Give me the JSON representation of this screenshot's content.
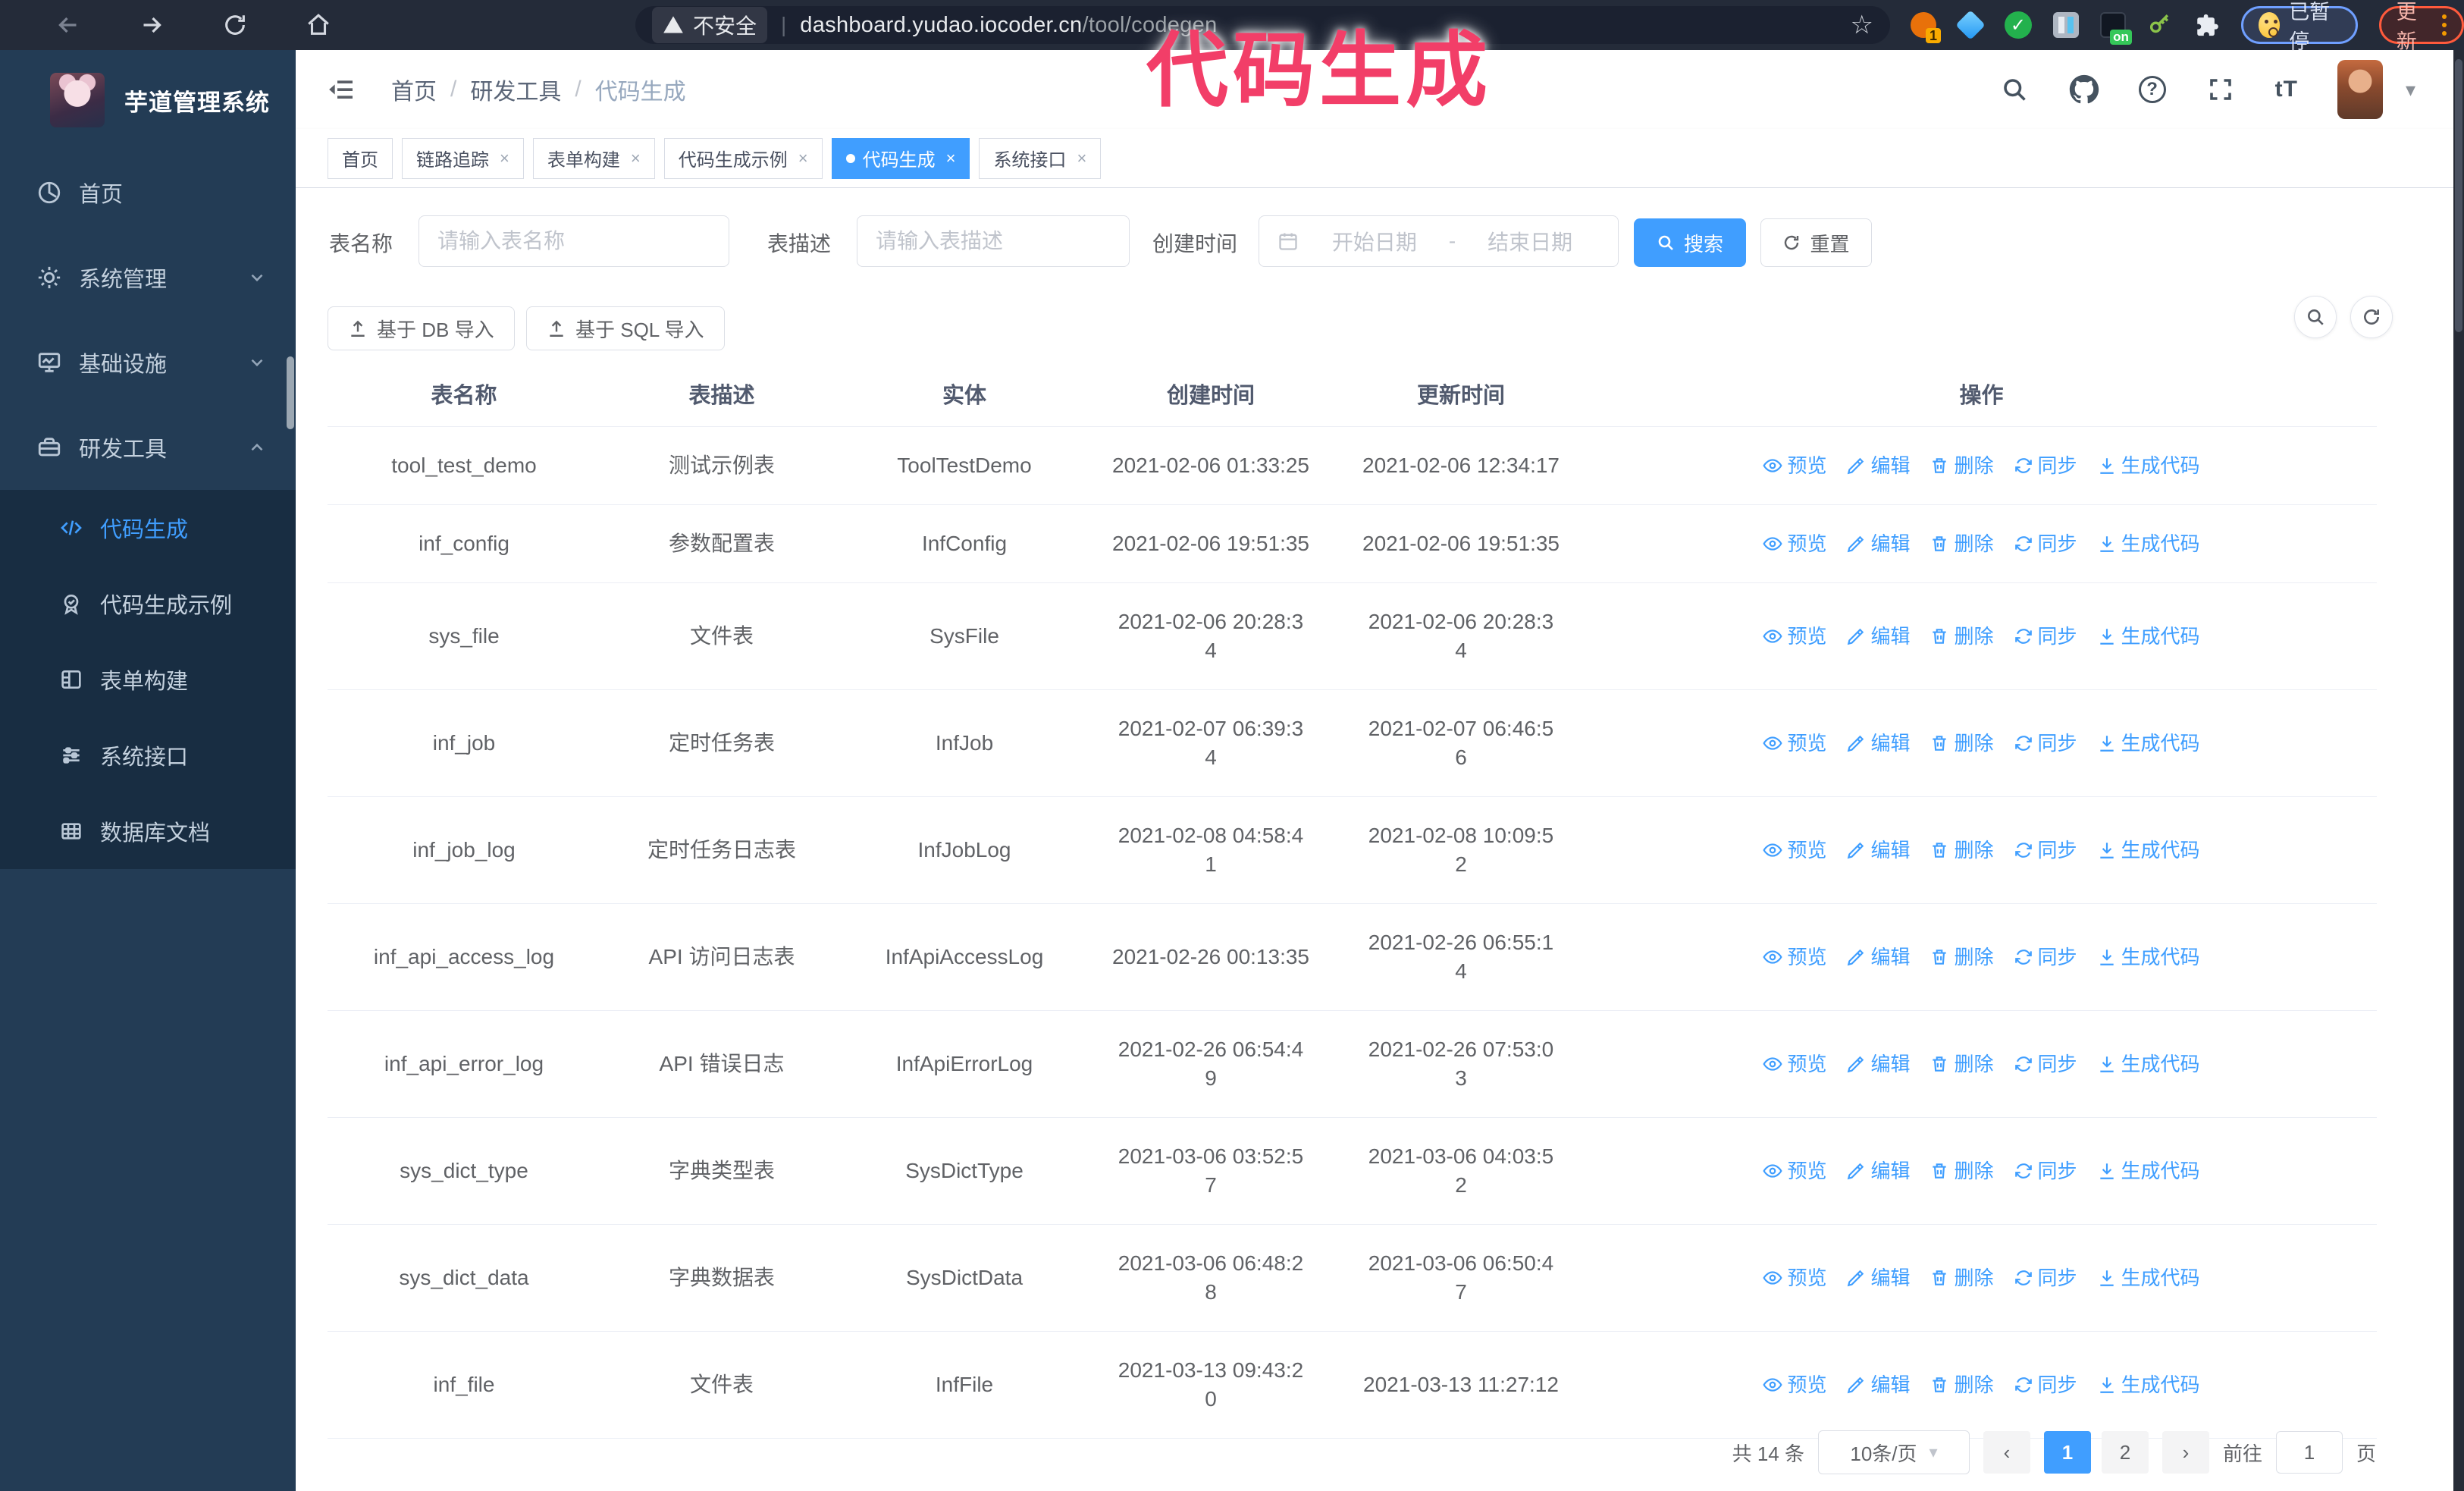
{
  "browser": {
    "security_label": "不安全",
    "url_domain": "dashboard.yudao.iocoder.cn",
    "url_path": "/tool/codegen",
    "extension_badge": "1",
    "extension_on_badge": "on",
    "paused_badge": "已暂停",
    "update_badge": "更新"
  },
  "annotation": {
    "text": "代码生成",
    "color": "#f23e68"
  },
  "sidebar": {
    "title": "芋道管理系统",
    "items": [
      {
        "label": "首页"
      },
      {
        "label": "系统管理"
      },
      {
        "label": "基础设施"
      },
      {
        "label": "研发工具"
      }
    ],
    "subitems": [
      {
        "label": "代码生成",
        "active": true
      },
      {
        "label": "代码生成示例",
        "active": false
      },
      {
        "label": "表单构建",
        "active": false
      },
      {
        "label": "系统接口",
        "active": false
      },
      {
        "label": "数据库文档",
        "active": false
      }
    ]
  },
  "breadcrumb": {
    "items": [
      "首页",
      "研发工具",
      "代码生成"
    ]
  },
  "tags": [
    {
      "label": "首页",
      "closable": false,
      "active": false
    },
    {
      "label": "链路追踪",
      "closable": true,
      "active": false
    },
    {
      "label": "表单构建",
      "closable": true,
      "active": false
    },
    {
      "label": "代码生成示例",
      "closable": true,
      "active": false
    },
    {
      "label": "代码生成",
      "closable": true,
      "active": true
    },
    {
      "label": "系统接口",
      "closable": true,
      "active": false
    }
  ],
  "filters": {
    "name_label": "表名称",
    "name_placeholder": "请输入表名称",
    "desc_label": "表描述",
    "desc_placeholder": "请输入表描述",
    "time_label": "创建时间",
    "start_placeholder": "开始日期",
    "range_separator": "-",
    "end_placeholder": "结束日期",
    "search_label": "搜索",
    "reset_label": "重置"
  },
  "toolbar": {
    "import_db_label": "基于 DB 导入",
    "import_sql_label": "基于 SQL 导入"
  },
  "table": {
    "headers": [
      "表名称",
      "表描述",
      "实体",
      "创建时间",
      "更新时间",
      "操作"
    ],
    "actions": [
      "预览",
      "编辑",
      "删除",
      "同步",
      "生成代码"
    ],
    "rows": [
      {
        "name": "tool_test_demo",
        "desc": "测试示例表",
        "entity": "ToolTestDemo",
        "created": "2021-02-06 01:33:25",
        "updated": "2021-02-06 12:34:17"
      },
      {
        "name": "inf_config",
        "desc": "参数配置表",
        "entity": "InfConfig",
        "created": "2021-02-06 19:51:35",
        "updated": "2021-02-06 19:51:35"
      },
      {
        "name": "sys_file",
        "desc": "文件表",
        "entity": "SysFile",
        "created": "2021-02-06 20:28:3\n4",
        "updated": "2021-02-06 20:28:3\n4"
      },
      {
        "name": "inf_job",
        "desc": "定时任务表",
        "entity": "InfJob",
        "created": "2021-02-07 06:39:3\n4",
        "updated": "2021-02-07 06:46:5\n6"
      },
      {
        "name": "inf_job_log",
        "desc": "定时任务日志表",
        "entity": "InfJobLog",
        "created": "2021-02-08 04:58:4\n1",
        "updated": "2021-02-08 10:09:5\n2"
      },
      {
        "name": "inf_api_access_log",
        "desc": "API 访问日志表",
        "entity": "InfApiAccessLog",
        "created": "2021-02-26 00:13:35",
        "updated": "2021-02-26 06:55:1\n4"
      },
      {
        "name": "inf_api_error_log",
        "desc": "API 错误日志",
        "entity": "InfApiErrorLog",
        "created": "2021-02-26 06:54:4\n9",
        "updated": "2021-02-26 07:53:0\n3"
      },
      {
        "name": "sys_dict_type",
        "desc": "字典类型表",
        "entity": "SysDictType",
        "created": "2021-03-06 03:52:5\n7",
        "updated": "2021-03-06 04:03:5\n2"
      },
      {
        "name": "sys_dict_data",
        "desc": "字典数据表",
        "entity": "SysDictData",
        "created": "2021-03-06 06:48:2\n8",
        "updated": "2021-03-06 06:50:4\n7"
      },
      {
        "name": "inf_file",
        "desc": "文件表",
        "entity": "InfFile",
        "created": "2021-03-13 09:43:2\n0",
        "updated": "2021-03-13 11:27:12"
      }
    ]
  },
  "pagination": {
    "total_label": "共 14 条",
    "page_size_label": "10条/页",
    "prev": "‹",
    "next": "›",
    "pages": [
      "1",
      "2"
    ],
    "active_page": "1",
    "goto_label": "前往",
    "goto_value": "1",
    "page_suffix": "页"
  },
  "colors": {
    "primary": "#409eff",
    "sidebar_bg": "#233c55",
    "submenu_bg": "#182d42",
    "chrome_bg": "#242b39",
    "annotation": "#f23e68"
  }
}
